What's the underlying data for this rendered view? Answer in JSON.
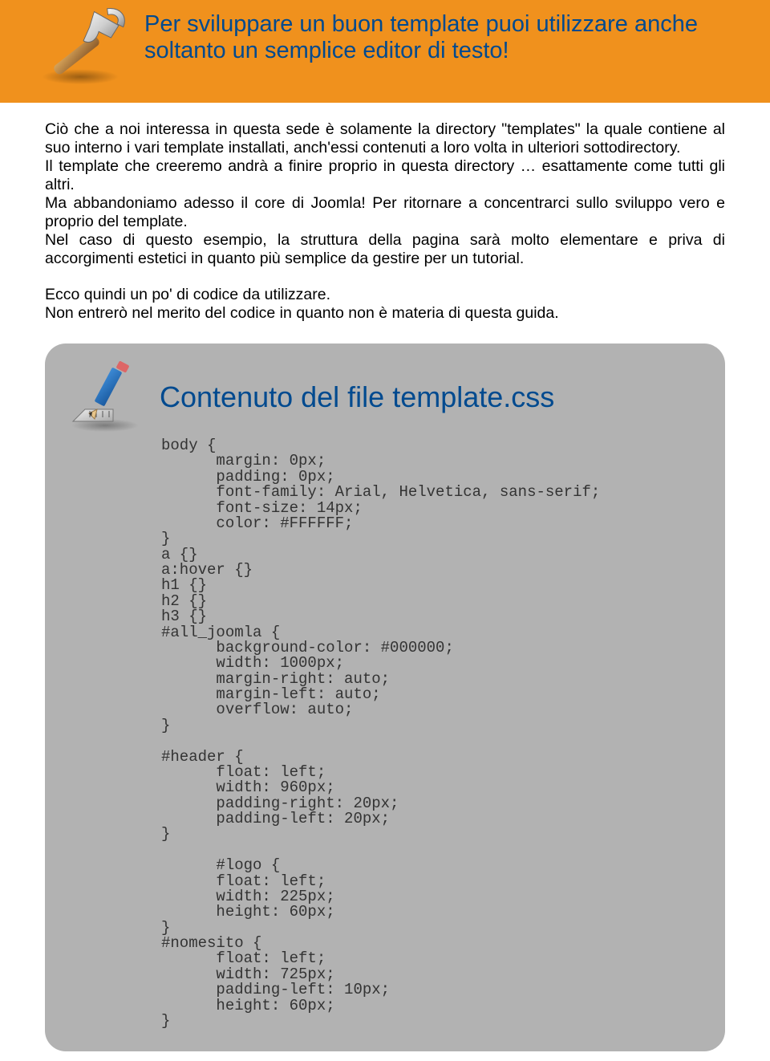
{
  "banner": {
    "text": "Per sviluppare un buon template puoi utilizzare anche soltanto un semplice editor di testo!"
  },
  "body": {
    "p1": "Ciò che a noi interessa in questa sede è solamente la directory \"templates\" la quale contiene al suo interno i vari template installati, anch'essi contenuti a loro volta in ulteriori sottodirectory.",
    "p2": "Il template che creeremo andrà a finire proprio in questa directory … esattamente come tutti gli altri.",
    "p3": "Ma abbandoniamo adesso il core di Joomla! Per ritornare a concentrarci sullo sviluppo vero e proprio del template.",
    "p4": "Nel caso di questo esempio, la struttura della pagina sarà molto elementare e priva di accorgimenti estetici in quanto più semplice da gestire per un tutorial.",
    "p5": "Ecco quindi un po' di codice da utilizzare.",
    "p6": "Non entrerò nel merito del codice in quanto non è materia di questa guida."
  },
  "codepanel": {
    "title": "Contenuto del file template.css",
    "code": "body {\n      margin: 0px;\n      padding: 0px;\n      font-family: Arial, Helvetica, sans-serif;\n      font-size: 14px;\n      color: #FFFFFF;\n}\na {}\na:hover {}\nh1 {}\nh2 {}\nh3 {}\n#all_joomla {\n      background-color: #000000;\n      width: 1000px;\n      margin-right: auto;\n      margin-left: auto;\n      overflow: auto;\n}\n\n#header {\n      float: left;\n      width: 960px;\n      padding-right: 20px;\n      padding-left: 20px;\n}\n\n      #logo {\n      float: left;\n      width: 225px;\n      height: 60px;\n}\n#nomesito {\n      float: left;\n      width: 725px;\n      padding-left: 10px;\n      height: 60px;\n}"
  }
}
